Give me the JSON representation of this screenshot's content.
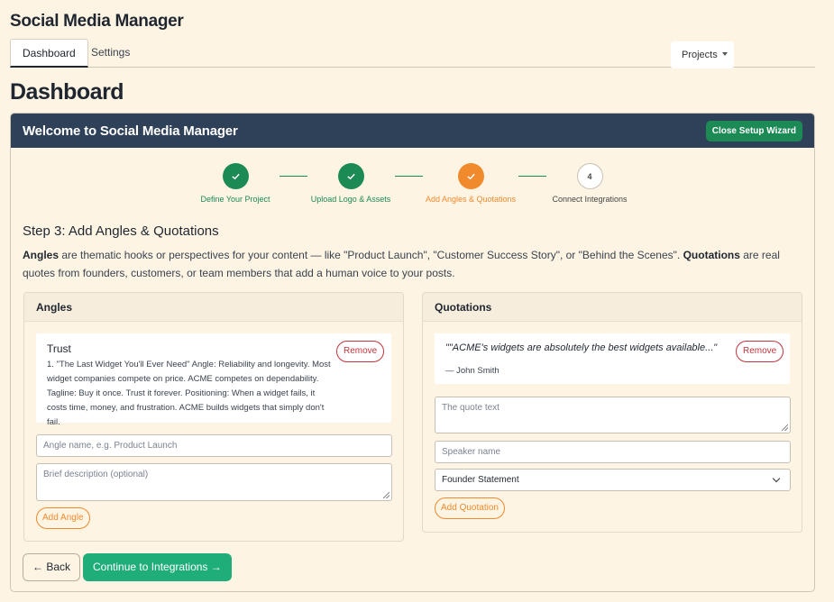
{
  "app": {
    "title": "Social Media Manager"
  },
  "nav": {
    "tabs": [
      {
        "label": "Dashboard"
      },
      {
        "label": "Settings"
      }
    ],
    "projects_label": "Projects"
  },
  "page": {
    "title": "Dashboard"
  },
  "wizard": {
    "title": "Welcome to Social Media Manager",
    "close_label": "Close Setup Wizard",
    "steps": [
      {
        "label": "Define Your Project",
        "status": "done",
        "icon": "check-icon"
      },
      {
        "label": "Upload Logo & Assets",
        "status": "done",
        "icon": "check-icon"
      },
      {
        "label": "Add Angles & Quotations",
        "status": "current",
        "icon": "check-icon"
      },
      {
        "label": "Connect Integrations",
        "status": "todo",
        "number": "4"
      }
    ],
    "section_title": "Step 3: Add Angles & Quotations",
    "intro": {
      "angles_term": "Angles",
      "angles_text": " are thematic hooks or perspectives for your content — like \"Product Launch\", \"Customer Success Story\", or \"Behind the Scenes\". ",
      "quotations_term": "Quotations",
      "quotations_text": " are real quotes from founders, customers, or team members that add a human voice to your posts."
    },
    "angles": {
      "title": "Angles",
      "items": [
        {
          "name": "Trust",
          "description": "1. \"The Last Widget You'll Ever Need\" Angle: Reliability and longevity. Most widget companies compete on price. ACME competes on dependability. Tagline: Buy it once. Trust it forever. Positioning: When a widget fails, it costs time, money, and frustration. ACME builds widgets that simply don't fail.",
          "remove_label": "Remove"
        }
      ],
      "name_placeholder": "Angle name, e.g. Product Launch",
      "description_placeholder": "Brief description (optional)",
      "add_label": "Add Angle"
    },
    "quotations": {
      "title": "Quotations",
      "items": [
        {
          "quote": "\"\"ACME's widgets are absolutely the best widgets available...\"",
          "speaker": "— John Smith",
          "remove_label": "Remove"
        }
      ],
      "quote_placeholder": "The quote text",
      "speaker_placeholder": "Speaker name",
      "type_selected": "Founder Statement",
      "add_label": "Add Quotation"
    },
    "back_label": "← Back",
    "continue_label": "Continue to Integrations →"
  },
  "colors": {
    "background": "#fdf4e3",
    "header": "#2e4158",
    "success": "#1c8a55",
    "current": "#f08a2c",
    "danger": "#c0353d",
    "primary": "#1fae7a"
  }
}
